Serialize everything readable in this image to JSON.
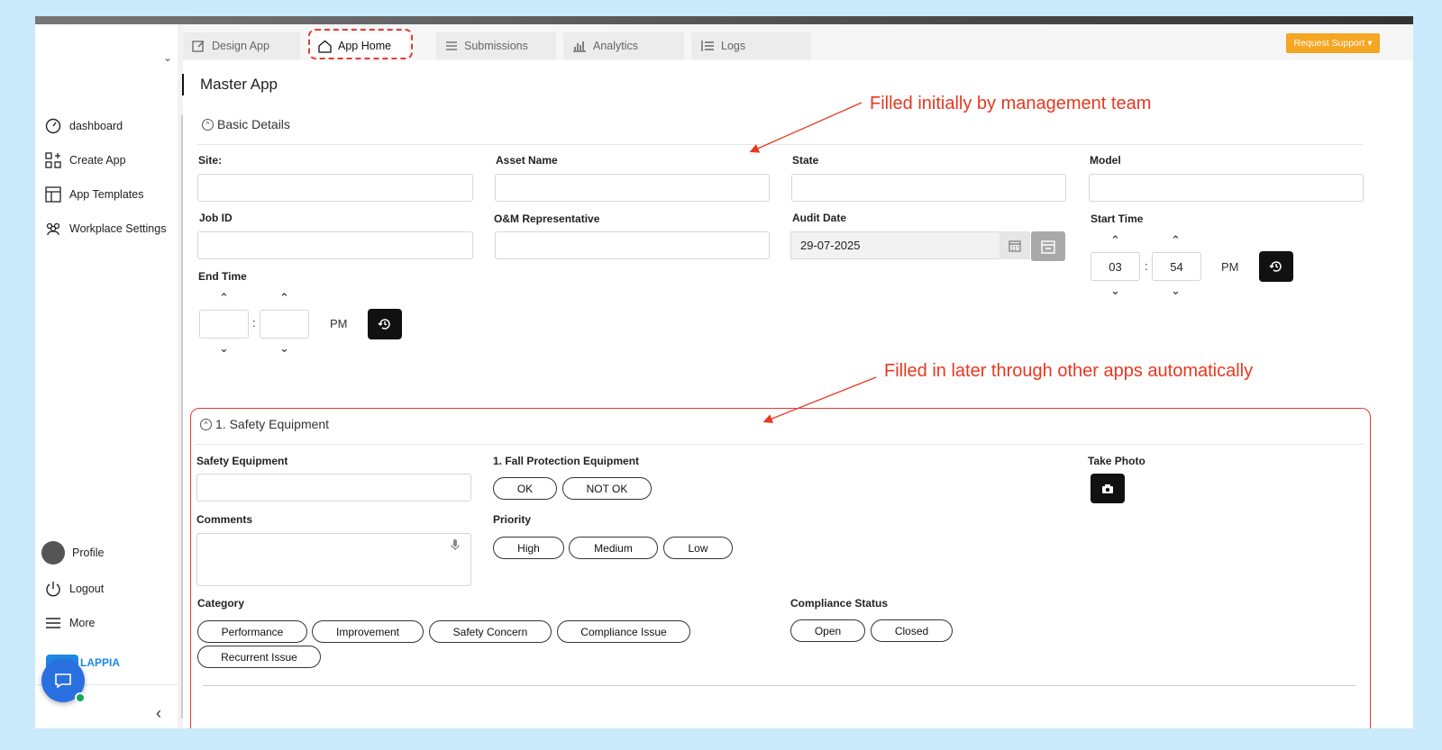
{
  "sidebar": {
    "items": [
      {
        "label": "dashboard",
        "icon": "gauge-icon"
      },
      {
        "label": "Create App",
        "icon": "grid-plus-icon"
      },
      {
        "label": "App Templates",
        "icon": "template-icon"
      },
      {
        "label": "Workplace Settings",
        "icon": "users-gear-icon"
      }
    ],
    "profile": "Profile",
    "logout": "Logout",
    "more": "More",
    "logo_text": "LAPPIA"
  },
  "tabs": [
    {
      "label": "Design App",
      "icon": "edit-icon"
    },
    {
      "label": "App Home",
      "icon": "home-icon",
      "active": true
    },
    {
      "label": "Submissions",
      "icon": "list-icon"
    },
    {
      "label": "Analytics",
      "icon": "bar-chart-icon"
    },
    {
      "label": "Logs",
      "icon": "logs-icon"
    }
  ],
  "request_support": "Request Support ▾",
  "page_title": "Master App",
  "basic": {
    "header": "Basic Details",
    "fields": {
      "site": "Site:",
      "asset_name": "Asset Name",
      "state": "State",
      "model": "Model",
      "job_id": "Job ID",
      "om_rep": "O&M Representative",
      "audit_date": "Audit Date",
      "audit_date_value": "29-07-2025",
      "start_time": "Start Time",
      "start_hour": "03",
      "start_min": "54",
      "start_ampm": "PM",
      "end_time": "End Time",
      "end_ampm": "PM"
    }
  },
  "annotations": {
    "top": "Filled initially by management team",
    "bottom": "Filled in later through other apps automatically"
  },
  "safety": {
    "header": "1. Safety Equipment",
    "safety_equipment": "Safety Equipment",
    "fall_protection": "1. Fall Protection Equipment",
    "ok": "OK",
    "not_ok": "NOT OK",
    "take_photo": "Take Photo",
    "comments": "Comments",
    "priority": "Priority",
    "priority_options": [
      "High",
      "Medium",
      "Low"
    ],
    "category": "Category",
    "category_options": [
      "Performance",
      "Improvement",
      "Safety Concern",
      "Compliance Issue",
      "Recurrent Issue"
    ],
    "compliance_status": "Compliance Status",
    "compliance_options": [
      "Open",
      "Closed"
    ]
  },
  "colors": {
    "accent": "#f5a623",
    "annotation": "#e8381f",
    "brand": "#1e88e5"
  }
}
